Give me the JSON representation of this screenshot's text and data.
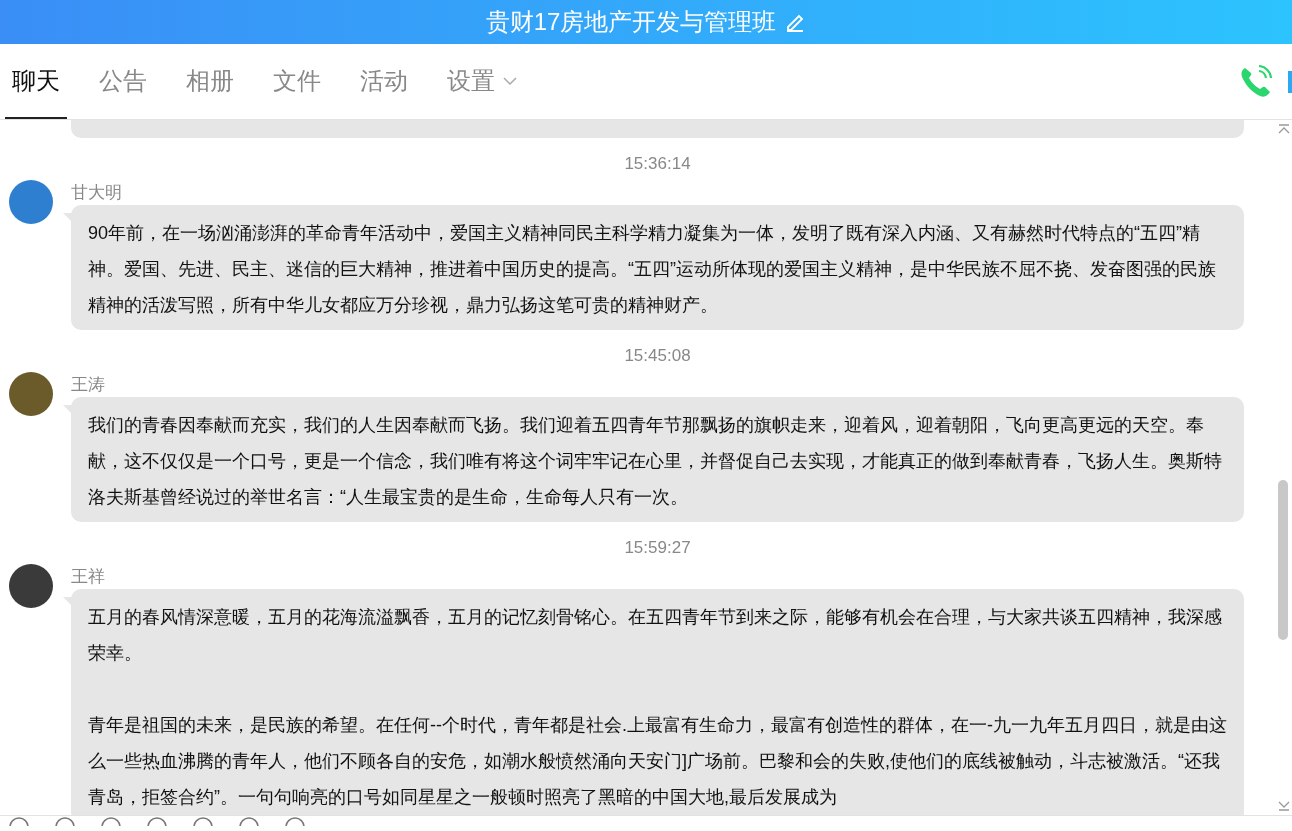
{
  "window": {
    "title": "贵财17房地产开发与管理班"
  },
  "tabs": [
    {
      "label": "聊天",
      "selected": true,
      "dropdown": false
    },
    {
      "label": "公告",
      "selected": false,
      "dropdown": false
    },
    {
      "label": "相册",
      "selected": false,
      "dropdown": false
    },
    {
      "label": "文件",
      "selected": false,
      "dropdown": false
    },
    {
      "label": "活动",
      "selected": false,
      "dropdown": false
    },
    {
      "label": "设置",
      "selected": false,
      "dropdown": true
    }
  ],
  "messages": [
    {
      "time": "15:36:14",
      "sender": "甘大明",
      "color": "#2f7fd0",
      "paragraphs": [
        "90年前，在一场汹涌澎湃的革命青年活动中，爱国主义精神同民主科学精力凝集为一体，发明了既有深入内涵、又有赫然时代特点的“五四”精神。爱国、先进、民主、迷信的巨大精神，推进着中国历史的提高。“五四”运动所体现的爱国主义精神，是中华民族不屈不挠、发奋图强的民族精神的活泼写照，所有中华儿女都应万分珍视，鼎力弘扬这笔可贵的精神财产。"
      ]
    },
    {
      "time": "15:45:08",
      "sender": "王涛",
      "color": "#6b5a2a",
      "paragraphs": [
        "我们的青春因奉献而充实，我们的人生因奉献而飞扬。我们迎着五四青年节那飘扬的旗帜走来，迎着风，迎着朝阳，飞向更高更远的天空。奉献，这不仅仅是一个口号，更是一个信念，我们唯有将这个词牢牢记在心里，并督促自己去实现，才能真正的做到奉献青春，飞扬人生。奥斯特洛夫斯基曾经说过的举世名言：“人生最宝贵的是生命，生命每人只有一次。"
      ]
    },
    {
      "time": "15:59:27",
      "sender": "王祥",
      "color": "#3a3a3a",
      "paragraphs": [
        "五月的春风情深意暖，五月的花海流溢飘香，五月的记忆刻骨铭心。在五四青年节到来之际，能够有机会在合理，与大家共谈五四精神，我深感荣幸。",
        "青年是祖国的未来，是民族的希望。在任何--个时代，青年都是社会.上最富有生命力，最富有创造性的群体，在一-九一九年五月四日，就是由这么一些热血沸腾的青年人，他们不顾各自的安危，如潮水般愤然涌向天安门]广场前。巴黎和会的失败,使他们的底线被触动，斗志被激活。“还我青岛，拒签合约”。一句句响亮的口号如同星星之一般顿时照亮了黑暗的中国大地,最后发展成为"
      ]
    }
  ]
}
